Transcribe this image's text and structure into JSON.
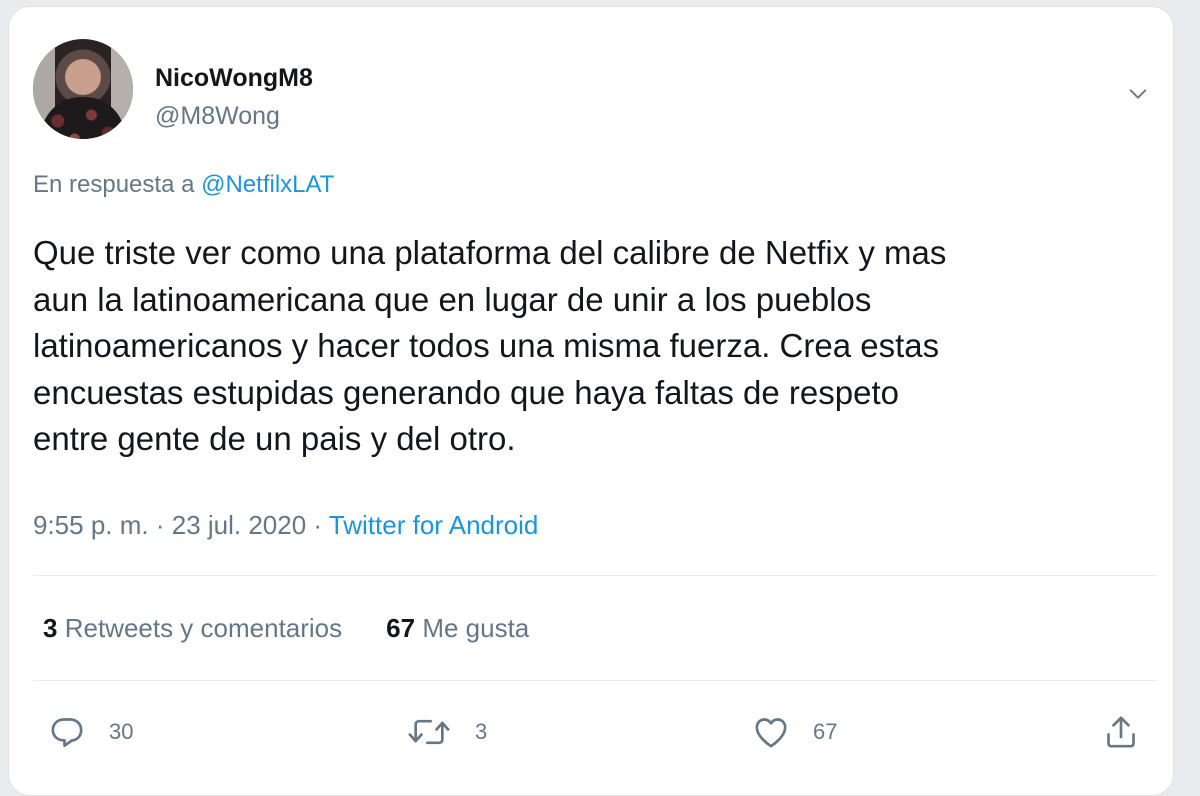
{
  "user": {
    "display_name": "NicoWongM8",
    "handle": "@M8Wong"
  },
  "reply": {
    "prefix": "En respuesta a ",
    "mention": "@NetfilxLAT"
  },
  "tweet": {
    "text": "Que triste ver como una plataforma del calibre de Netfix y mas\naun la latinoamericana que en lugar de unir a los pueblos\nlatinoamericanos  y hacer todos una misma fuerza. Crea estas\nencuestas estupidas  generando que haya faltas de respeto\nentre gente de un pais y del otro.",
    "time": "9:55 p. m.",
    "date": "23 jul. 2020",
    "separator": " · ",
    "source": "Twitter for Android"
  },
  "stats": {
    "retweets_count": "3",
    "retweets_label": "Retweets y comentarios",
    "likes_count": "67",
    "likes_label": "Me gusta"
  },
  "actions": {
    "reply_count": "30",
    "retweet_count": "3",
    "like_count": "67"
  },
  "colors": {
    "link": "#1b95e0",
    "secondary_text": "#657786",
    "primary_text": "#14171a"
  },
  "icons": [
    "chevron-down-icon",
    "reply-icon",
    "retweet-icon",
    "like-icon",
    "share-icon"
  ]
}
